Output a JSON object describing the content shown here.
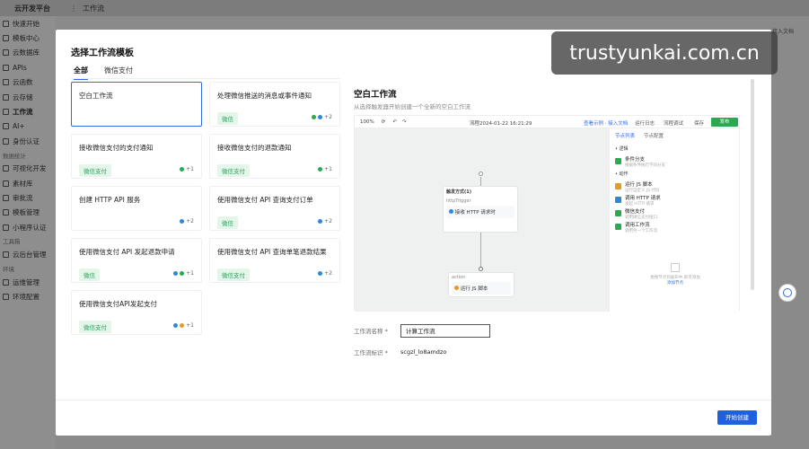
{
  "topbar": {
    "brand": "云开发平台",
    "page": "工作流"
  },
  "sidebar": {
    "items": [
      {
        "label": "快速开始",
        "group": false
      },
      {
        "label": "模板中心",
        "group": false
      },
      {
        "label": "云数据库",
        "group": false
      },
      {
        "label": "APIs",
        "group": false
      },
      {
        "label": "云函数",
        "group": false
      },
      {
        "label": "云存储",
        "group": false
      },
      {
        "label": "工作流",
        "group": false,
        "active": true
      },
      {
        "label": "AI+",
        "group": false
      },
      {
        "label": "身份认证",
        "group": false
      },
      {
        "label": "数据统计",
        "group": true
      },
      {
        "label": "可视化开发",
        "group": false
      },
      {
        "label": "素材库",
        "group": false
      },
      {
        "label": "审批流",
        "group": false
      },
      {
        "label": "模板管理",
        "group": false
      },
      {
        "label": "小程序认证",
        "group": false
      },
      {
        "label": "工具箱",
        "group": true
      },
      {
        "label": "云后台管理",
        "group": false
      },
      {
        "label": "环境",
        "group": true
      },
      {
        "label": "运维管理",
        "group": false
      },
      {
        "label": "环境配置",
        "group": false
      }
    ]
  },
  "bg_right_text": "接入文档",
  "modal": {
    "title": "选择工作流模板",
    "close": "×",
    "tabs": [
      {
        "label": "全部",
        "active": true
      },
      {
        "label": "微信支付",
        "active": false
      }
    ],
    "cards": [
      {
        "title": "空白工作流",
        "badge": "",
        "meta": "",
        "selected": true
      },
      {
        "title": "处理微信推送的消息或事件通知",
        "badge": "微信",
        "meta": "+2"
      },
      {
        "title": "接收微信支付的支付通知",
        "badge": "微信支付",
        "meta": "+1"
      },
      {
        "title": "接收微信支付的退款通知",
        "badge": "微信支付",
        "meta": "+1"
      },
      {
        "title": "创建 HTTP API 服务",
        "badge": "",
        "meta": "+2"
      },
      {
        "title": "使用微信支付 API 查询支付订单",
        "badge": "微信",
        "meta": "+2"
      },
      {
        "title": "使用微信支付 API 发起退款申请",
        "badge": "微信",
        "meta": "+1"
      },
      {
        "title": "使用微信支付 API 查询单笔退款结果",
        "badge": "微信支付",
        "meta": "+2"
      },
      {
        "title": "使用微信支付API发起支付",
        "badge": "微信支付",
        "meta": "+1"
      }
    ],
    "panel": {
      "title": "空白工作流",
      "desc": "从选择触发器开始创建一个全新的空白工作流",
      "preview": {
        "zoom": "100%",
        "flow_title": "流程2024-01-22 16:21:29",
        "toolbar_right": [
          "查看示例 · 接入文档",
          "运行日志",
          "流程调试",
          "保存"
        ],
        "run": "发布",
        "trigger_node_title": "触发方式(1)",
        "trigger_node_sub": "httpTrigger",
        "trigger_node_body": "接收 HTTP 请求时",
        "action_node_sub": "action",
        "action_node_body": "运行 JS 脚本",
        "side_tabs": [
          "节点列表",
          "节点配置"
        ],
        "side_groups": [
          "• 逻辑",
          "• 动作"
        ],
        "side_items": [
          {
            "label": "条件分支",
            "sub": "根据条件执行不同分支",
            "color": "#2aa94f"
          },
          {
            "label": "运行 JS 脚本",
            "sub": "运行自定义 JS 代码",
            "color": "#e29a28"
          },
          {
            "label": "调用 HTTP 请求",
            "sub": "发起 HTTP 请求",
            "color": "#2d88d8"
          },
          {
            "label": "微信支付",
            "sub": "调用微信支付接口",
            "color": "#2aa94f"
          },
          {
            "label": "调用工作流",
            "sub": "调用另一个工作流",
            "color": "#2aa94f"
          }
        ],
        "side_empty": "拖拽节点到画布中,即可添加",
        "side_empty_link": "添加节点"
      },
      "form": {
        "name_label": "工作流名称 *",
        "name_value": "计算工作流",
        "id_label": "工作流标识 *",
        "id_value": "scgzl_lo8amdzo"
      }
    },
    "create_button": "开始创建"
  },
  "watermark": "trustyunkai.com.cn"
}
